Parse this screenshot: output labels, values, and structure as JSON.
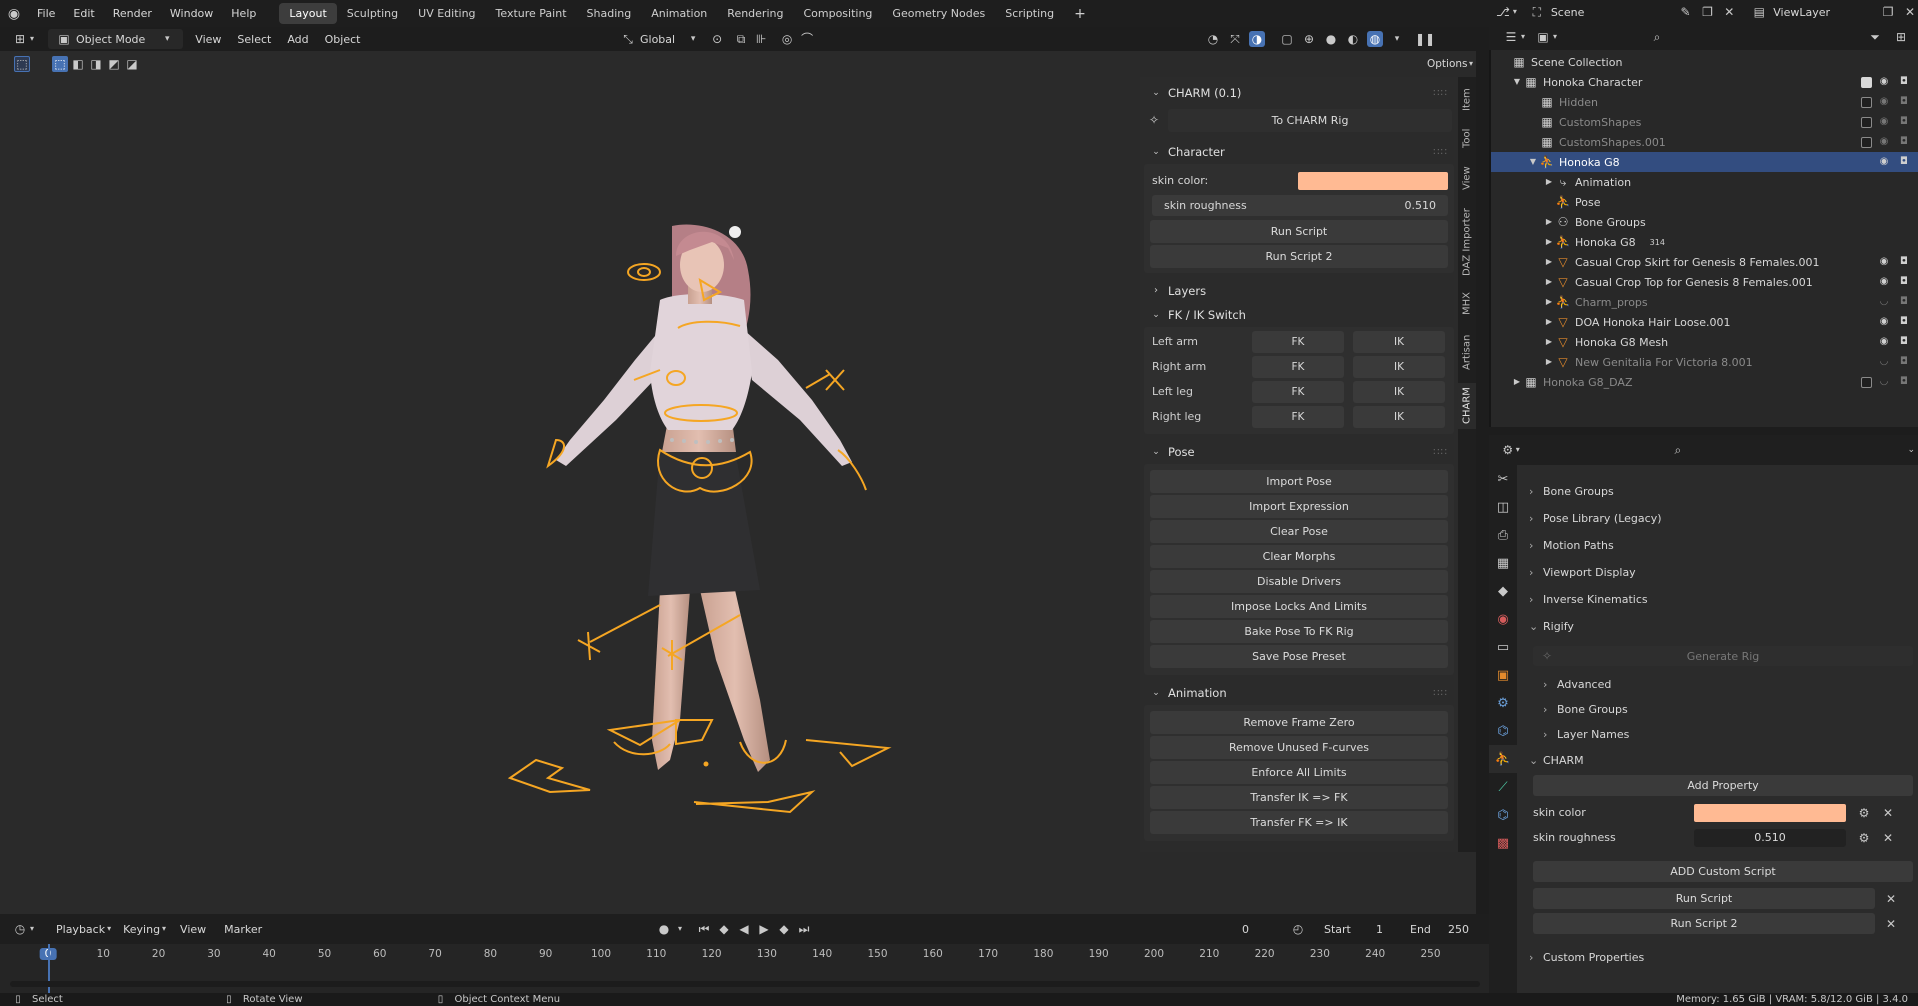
{
  "topbar": {
    "menus": [
      "File",
      "Edit",
      "Render",
      "Window",
      "Help"
    ],
    "workspaces": [
      "Layout",
      "Sculpting",
      "UV Editing",
      "Texture Paint",
      "Shading",
      "Animation",
      "Rendering",
      "Compositing",
      "Geometry Nodes",
      "Scripting"
    ],
    "active_workspace": "Layout",
    "add_workspace": "+",
    "scene_label": "Scene",
    "viewlayer_label": "ViewLayer"
  },
  "viewport_header": {
    "mode": "Object Mode",
    "menus": [
      "View",
      "Select",
      "Add",
      "Object"
    ],
    "orientation": "Global",
    "options": "Options"
  },
  "npanel": {
    "title": "CHARM (0.1)",
    "to_charm_rig": "To CHARM Rig",
    "character": {
      "title": "Character",
      "skin_color_label": "skin color:",
      "skin_color": "#ffba93",
      "skin_roughness_label": "skin roughness",
      "skin_roughness": "0.510",
      "run_script": "Run Script",
      "run_script_2": "Run Script 2"
    },
    "layers": "Layers",
    "fkik": {
      "title": "FK / IK Switch",
      "rows": [
        {
          "label": "Left arm",
          "fk": "FK",
          "ik": "IK"
        },
        {
          "label": "Right arm",
          "fk": "FK",
          "ik": "IK"
        },
        {
          "label": "Left leg",
          "fk": "FK",
          "ik": "IK"
        },
        {
          "label": "Right leg",
          "fk": "FK",
          "ik": "IK"
        }
      ]
    },
    "pose": {
      "title": "Pose",
      "buttons": [
        "Import Pose",
        "Import Expression",
        "Clear Pose",
        "Clear Morphs",
        "Disable Drivers",
        "Impose Locks And Limits",
        "Bake Pose To FK Rig",
        "Save Pose Preset"
      ]
    },
    "animation": {
      "title": "Animation",
      "buttons": [
        "Remove Frame Zero",
        "Remove Unused F-curves",
        "Enforce All Limits",
        "Transfer IK => FK",
        "Transfer FK => IK"
      ]
    }
  },
  "vtabs": [
    "Item",
    "Tool",
    "View",
    "DAZ Importer",
    "MHX",
    "Artisan",
    "CHARM"
  ],
  "outliner": {
    "root": "Scene Collection",
    "rows": [
      {
        "label": "Honoka Character",
        "indent": 1,
        "dim": false
      },
      {
        "label": "Hidden",
        "indent": 2,
        "dim": true
      },
      {
        "label": "CustomShapes",
        "indent": 2,
        "dim": true
      },
      {
        "label": "CustomShapes.001",
        "indent": 2,
        "dim": true
      },
      {
        "label": "Honoka G8",
        "indent": 2,
        "dim": false,
        "selected": true
      },
      {
        "label": "Animation",
        "indent": 3,
        "dim": false
      },
      {
        "label": "Pose",
        "indent": 3,
        "dim": false
      },
      {
        "label": "Bone Groups",
        "indent": 3,
        "dim": false
      },
      {
        "label": "Honoka G8",
        "indent": 3,
        "dim": false,
        "badge": "314"
      },
      {
        "label": "Casual Crop Skirt for Genesis 8 Females.001",
        "indent": 3,
        "dim": false
      },
      {
        "label": "Casual Crop Top for Genesis 8 Females.001",
        "indent": 3,
        "dim": false
      },
      {
        "label": "Charm_props",
        "indent": 3,
        "dim": true
      },
      {
        "label": "DOA Honoka Hair Loose.001",
        "indent": 3,
        "dim": false
      },
      {
        "label": "Honoka G8 Mesh",
        "indent": 3,
        "dim": false
      },
      {
        "label": "New Genitalia For Victoria 8.001",
        "indent": 3,
        "dim": true
      },
      {
        "label": "Honoka G8_DAZ",
        "indent": 1,
        "dim": true
      }
    ]
  },
  "properties": {
    "sections": [
      "Bone Groups",
      "Pose Library (Legacy)",
      "Motion Paths",
      "Viewport Display",
      "Inverse Kinematics"
    ],
    "rigify": {
      "title": "Rigify",
      "generate_rig": "Generate Rig",
      "subs": [
        "Advanced",
        "Bone Groups",
        "Layer Names"
      ]
    },
    "charm": {
      "title": "CHARM",
      "add_property": "Add Property",
      "skin_color_label": "skin color",
      "skin_color": "#ffba93",
      "skin_roughness_label": "skin roughness",
      "skin_roughness": "0.510",
      "add_custom_script": "ADD Custom Script",
      "run_script": "Run Script",
      "run_script_2": "Run Script 2"
    },
    "custom_properties": "Custom Properties"
  },
  "timeline": {
    "menus": [
      "Playback",
      "Keying",
      "View",
      "Marker"
    ],
    "current_frame": "0",
    "start_label": "Start",
    "start": "1",
    "end_label": "End",
    "end": "250",
    "ticks": [
      "0",
      "10",
      "20",
      "30",
      "40",
      "50",
      "60",
      "70",
      "80",
      "90",
      "100",
      "110",
      "120",
      "130",
      "140",
      "150",
      "160",
      "170",
      "180",
      "190",
      "200",
      "210",
      "220",
      "230",
      "240",
      "250"
    ]
  },
  "statusbar": {
    "select": "Select",
    "rotate": "Rotate View",
    "context": "Object Context Menu",
    "memory": "Memory: 1.65 GiB | VRAM: 5.8/12.0 GiB | 3.4.0"
  },
  "colors": {
    "accent": "#334d80",
    "bone": "#f5a623",
    "skin": "#ffba93"
  }
}
